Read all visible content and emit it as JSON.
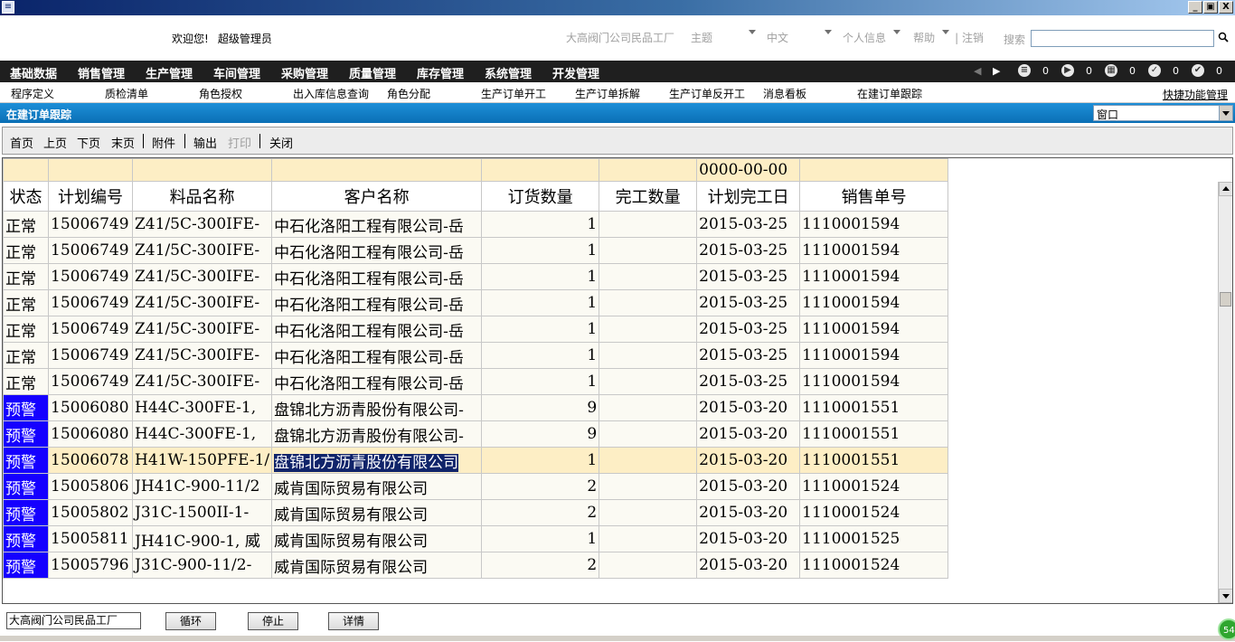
{
  "titlebar": {
    "icon": "app-icon",
    "buttons": [
      "_",
      "▣",
      "X"
    ]
  },
  "topbar": {
    "welcome": "欢迎您!",
    "user": "超级管理员",
    "company": "大高阀门公司民品工厂",
    "theme": "主题",
    "language": "中文",
    "personal": "个人信息",
    "help": "帮助",
    "logout": "注销",
    "search_label": "搜索",
    "search_value": ""
  },
  "main_menu": [
    "基础数据",
    "销售管理",
    "生产管理",
    "车间管理",
    "采购管理",
    "质量管理",
    "库存管理",
    "系统管理",
    "开发管理"
  ],
  "menu_counters": [
    "0",
    "0",
    "0",
    "0",
    "0"
  ],
  "quick_links": [
    "程序定义",
    "质检清单",
    "角色授权",
    "出入库信息查询",
    "角色分配",
    "生产订单开工",
    "生产订单拆解",
    "生产订单反开工",
    "消息看板",
    "在建订单跟踪"
  ],
  "quick_links_more": "快捷功能管理",
  "window": {
    "title": "在建订单跟踪",
    "selector_value": "窗口"
  },
  "toolbar": {
    "first": "首页",
    "prev": "上页",
    "next": "下页",
    "last": "末页",
    "attach": "附件",
    "export": "输出",
    "print": "打印",
    "close": "关闭"
  },
  "grid": {
    "filter_date": "0000-00-00",
    "columns": [
      "状态",
      "计划编号",
      "料品名称",
      "客户名称",
      "订货数量",
      "完工数量",
      "计划完工日",
      "销售单号"
    ],
    "rows": [
      [
        "正常",
        "15006749",
        "Z41/5C-300IFE-",
        "中石化洛阳工程有限公司-岳",
        "1",
        "",
        "2015-03-25",
        "1110001594"
      ],
      [
        "正常",
        "15006749",
        "Z41/5C-300IFE-",
        "中石化洛阳工程有限公司-岳",
        "1",
        "",
        "2015-03-25",
        "1110001594"
      ],
      [
        "正常",
        "15006749",
        "Z41/5C-300IFE-",
        "中石化洛阳工程有限公司-岳",
        "1",
        "",
        "2015-03-25",
        "1110001594"
      ],
      [
        "正常",
        "15006749",
        "Z41/5C-300IFE-",
        "中石化洛阳工程有限公司-岳",
        "1",
        "",
        "2015-03-25",
        "1110001594"
      ],
      [
        "正常",
        "15006749",
        "Z41/5C-300IFE-",
        "中石化洛阳工程有限公司-岳",
        "1",
        "",
        "2015-03-25",
        "1110001594"
      ],
      [
        "正常",
        "15006749",
        "Z41/5C-300IFE-",
        "中石化洛阳工程有限公司-岳",
        "1",
        "",
        "2015-03-25",
        "1110001594"
      ],
      [
        "正常",
        "15006749",
        "Z41/5C-300IFE-",
        "中石化洛阳工程有限公司-岳",
        "1",
        "",
        "2015-03-25",
        "1110001594"
      ],
      [
        "预警",
        "15006080",
        "H44C-300FE-1, ",
        "盘锦北方沥青股份有限公司-",
        "9",
        "",
        "2015-03-20",
        "1110001551"
      ],
      [
        "预警",
        "15006080",
        "H44C-300FE-1, ",
        "盘锦北方沥青股份有限公司-",
        "9",
        "",
        "2015-03-20",
        "1110001551"
      ],
      [
        "预警",
        "15006078",
        "H41W-150PFE-1/",
        "盘锦北方沥青股份有限公司",
        "1",
        "",
        "2015-03-20",
        "1110001551"
      ],
      [
        "预警",
        "15005806",
        "JH41C-900-11/2",
        "威肯国际贸易有限公司",
        "2",
        "",
        "2015-03-20",
        "1110001524"
      ],
      [
        "预警",
        "15005802",
        "J31C-1500II-1-",
        "威肯国际贸易有限公司",
        "2",
        "",
        "2015-03-20",
        "1110001524"
      ],
      [
        "预警",
        "15005811",
        "JH41C-900-1, 威",
        "威肯国际贸易有限公司",
        "1",
        "",
        "2015-03-20",
        "1110001525"
      ],
      [
        "预警",
        "15005796",
        "J31C-900-11/2-",
        "威肯国际贸易有限公司",
        "2",
        "",
        "2015-03-20",
        "1110001524"
      ]
    ],
    "selected_row": 9
  },
  "bottom": {
    "factory": "大高阀门公司民品工厂",
    "loop": "循环",
    "stop": "停止",
    "detail": "详情"
  },
  "badge": "54",
  "colors": {
    "warn": "#1500ff",
    "filter": "#fdeec5",
    "selected_text_bg": "#10246a",
    "menubar": "#1f1f1f",
    "windowbar": "#1d8fd8"
  }
}
